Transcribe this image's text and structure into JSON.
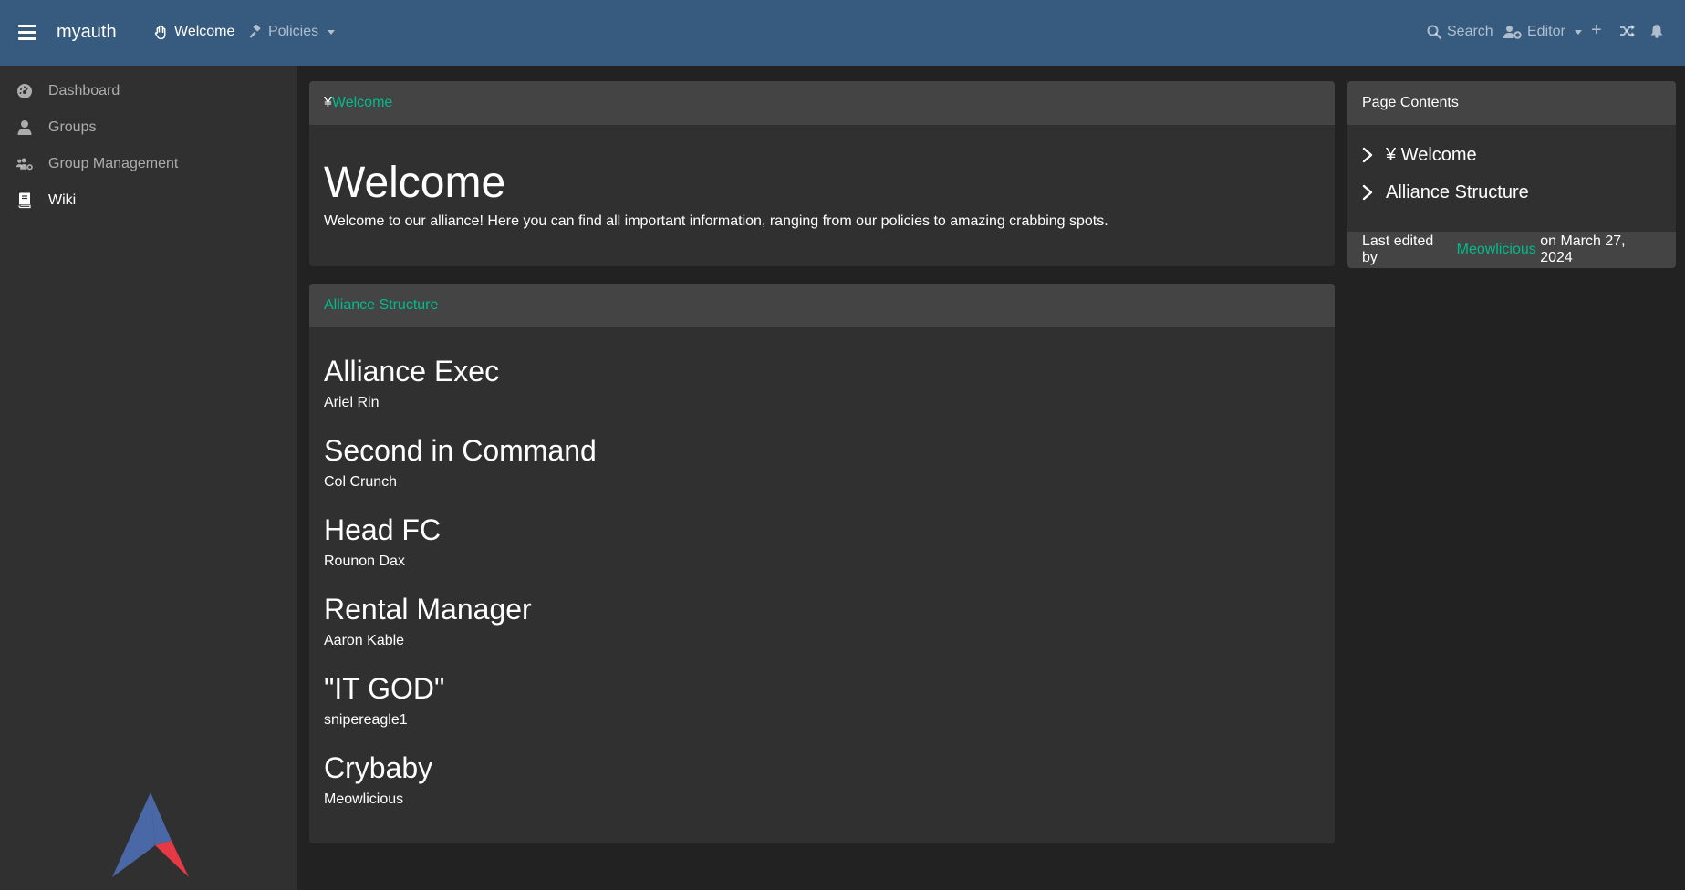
{
  "navbar": {
    "brand": "myauth",
    "welcome_label": "Welcome",
    "policies_label": "Policies",
    "search_label": "Search",
    "editor_label": "Editor",
    "plus_label": "+"
  },
  "sidebar": {
    "items": [
      {
        "label": "Dashboard",
        "icon": "dashboard-icon"
      },
      {
        "label": "Groups",
        "icon": "user-icon"
      },
      {
        "label": "Group Management",
        "icon": "users-gear-icon"
      },
      {
        "label": "Wiki",
        "icon": "book-icon"
      }
    ]
  },
  "welcome_card": {
    "header_symbol": "¥",
    "header_link": "Welcome",
    "title": "Welcome",
    "text": "Welcome to our alliance! Here you can find all important information, ranging from our policies to amazing crabbing spots."
  },
  "structure_card": {
    "header_link": "Alliance Structure",
    "roles": [
      {
        "title": "Alliance Exec",
        "name": "Ariel Rin"
      },
      {
        "title": "Second in Command",
        "name": "Col Crunch"
      },
      {
        "title": "Head FC",
        "name": "Rounon Dax"
      },
      {
        "title": "Rental Manager",
        "name": "Aaron Kable"
      },
      {
        "title": "\"IT GOD\"",
        "name": "snipereagle1"
      },
      {
        "title": "Crybaby",
        "name": "Meowlicious"
      }
    ]
  },
  "contents_card": {
    "header": "Page Contents",
    "items": [
      "¥ Welcome",
      "Alliance Structure"
    ],
    "footer_prefix": "Last edited by",
    "footer_user": "Meowlicious",
    "footer_suffix": "on March 27, 2024"
  },
  "colors": {
    "navbar": "#375a7f",
    "sidebar": "#303030",
    "background": "#222222",
    "card_header": "#444444",
    "link": "#00bc8c",
    "logo_blue": "#4a67a6",
    "logo_red": "#e63946"
  }
}
